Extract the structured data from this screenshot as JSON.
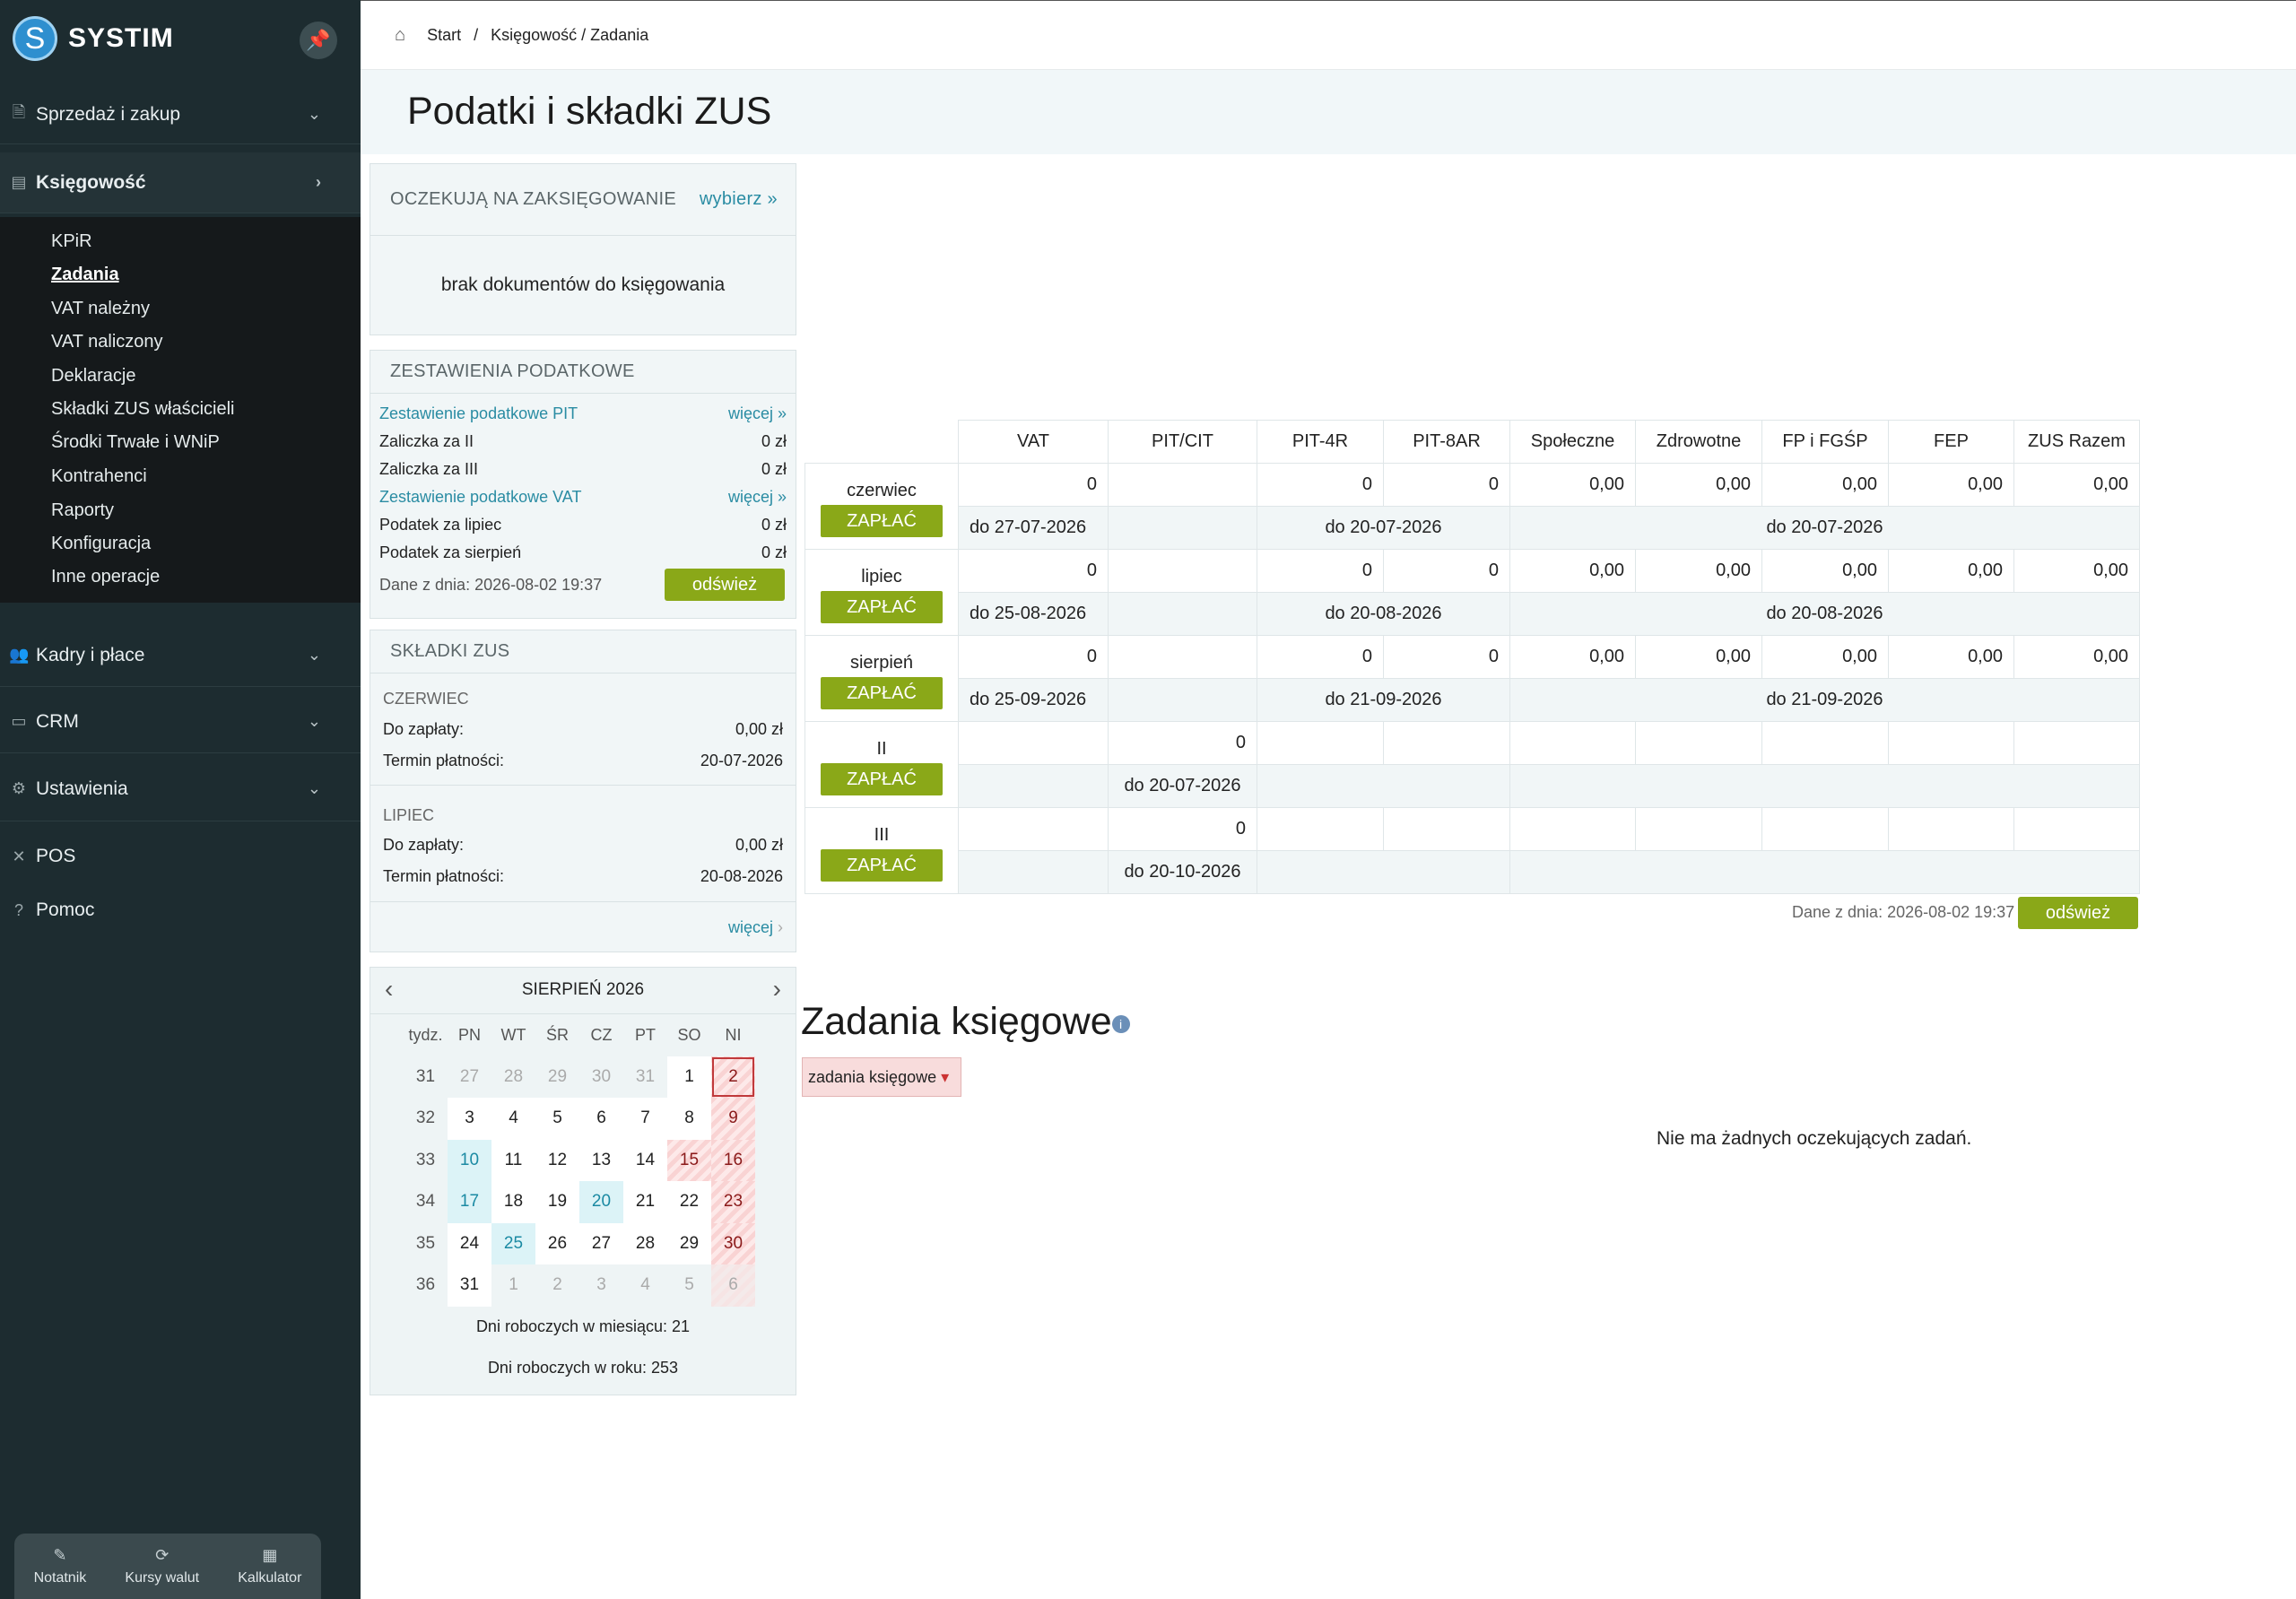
{
  "app": {
    "logo_letter": "S",
    "name": "SYSTIM"
  },
  "sidebar": {
    "sections": [
      {
        "label": "Sprzedaż i zakup",
        "icon": "receipt-icon"
      },
      {
        "label": "Księgowość",
        "icon": "ledger-icon"
      },
      {
        "label": "Kadry i płace",
        "icon": "people-icon"
      },
      {
        "label": "CRM",
        "icon": "card-icon"
      },
      {
        "label": "Ustawienia",
        "icon": "gear-icon"
      },
      {
        "label": "POS",
        "icon": "pos-icon"
      },
      {
        "label": "Pomoc",
        "icon": "help-icon"
      }
    ],
    "sub": [
      "KPiR",
      "Zadania",
      "VAT należny",
      "VAT naliczony",
      "Deklaracje",
      "Składki ZUS właścicieli",
      "Środki Trwałe i WNiP",
      "Kontrahenci",
      "Raporty",
      "Konfiguracja",
      "Inne operacje"
    ],
    "bottom": [
      "Notatnik",
      "Kursy walut",
      "Kalkulator"
    ]
  },
  "breadcrumb": {
    "start": "Start",
    "sep": "/",
    "current": "Księgowość / Zadania"
  },
  "page_title": "Podatki i składki ZUS",
  "pending": {
    "title": "OCZEKUJĄ NA ZAKSIĘGOWANIE",
    "action": "wybierz »",
    "empty": "brak dokumentów do księgowania"
  },
  "tax_summary": {
    "title": "ZESTAWIENIA PODATKOWE",
    "pit_link": "Zestawienie podatkowe PIT",
    "pit_more": "więcej »",
    "r1_label": "Zaliczka za II",
    "r1_value": "0 zł",
    "r2_label": "Zaliczka za III",
    "r2_value": "0 zł",
    "vat_link": "Zestawienie podatkowe VAT",
    "vat_more": "więcej »",
    "r3_label": "Podatek za lipiec",
    "r3_value": "0 zł",
    "r4_label": "Podatek za sierpień",
    "r4_value": "0 zł",
    "date": "Dane z dnia: 2026-08-02 19:37",
    "refresh": "odśwież"
  },
  "zus": {
    "title": "SKŁADKI ZUS",
    "m1": "CZERWIEC",
    "m1_due_label": "Do zapłaty:",
    "m1_due": "0,00 zł",
    "m1_term_label": "Termin płatności:",
    "m1_term": "20-07-2026",
    "m2": "LIPIEC",
    "m2_due_label": "Do zapłaty:",
    "m2_due": "0,00 zł",
    "m2_term_label": "Termin płatności:",
    "m2_term": "20-08-2026",
    "more": "więcej"
  },
  "calendar": {
    "title": "SIERPIEŃ 2026",
    "headers": [
      "tydz.",
      "PN",
      "WT",
      "ŚR",
      "CZ",
      "PT",
      "SO",
      "NI"
    ],
    "weeks": [
      [
        "31",
        "27",
        "28",
        "29",
        "30",
        "31",
        "1",
        "2"
      ],
      [
        "32",
        "3",
        "4",
        "5",
        "6",
        "7",
        "8",
        "9"
      ],
      [
        "33",
        "10",
        "11",
        "12",
        "13",
        "14",
        "15",
        "16"
      ],
      [
        "34",
        "17",
        "18",
        "19",
        "20",
        "21",
        "22",
        "23"
      ],
      [
        "35",
        "24",
        "25",
        "26",
        "27",
        "28",
        "29",
        "30"
      ],
      [
        "36",
        "31",
        "1",
        "2",
        "3",
        "4",
        "5",
        "6"
      ]
    ],
    "work_month": "Dni roboczych w miesiącu: 21",
    "work_year": "Dni roboczych w roku: 253"
  },
  "tax_table": {
    "columns": [
      "VAT",
      "PIT/CIT",
      "PIT-4R",
      "PIT-8AR",
      "Społeczne",
      "Zdrowotne",
      "FP i FGŚP",
      "FEP",
      "ZUS Razem"
    ],
    "pay_label": "ZAPŁAĆ",
    "months": [
      {
        "name": "czerwiec",
        "vat": "0",
        "pit4r": "0",
        "pit8ar": "0",
        "spol": "0,00",
        "zdr": "0,00",
        "fp": "0,00",
        "fep": "0,00",
        "zus": "0,00",
        "d_vat": "do 27-07-2026",
        "d_pit": "do 20-07-2026",
        "d_zus": "do 20-07-2026"
      },
      {
        "name": "lipiec",
        "vat": "0",
        "pit4r": "0",
        "pit8ar": "0",
        "spol": "0,00",
        "zdr": "0,00",
        "fp": "0,00",
        "fep": "0,00",
        "zus": "0,00",
        "d_vat": "do 25-08-2026",
        "d_pit": "do 20-08-2026",
        "d_zus": "do 20-08-2026"
      },
      {
        "name": "sierpień",
        "vat": "0",
        "pit4r": "0",
        "pit8ar": "0",
        "spol": "0,00",
        "zdr": "0,00",
        "fp": "0,00",
        "fep": "0,00",
        "zus": "0,00",
        "d_vat": "do 25-09-2026",
        "d_pit": "do 21-09-2026",
        "d_zus": "do 21-09-2026"
      }
    ],
    "quarters": [
      {
        "name": "II",
        "pit": "0",
        "d_pit": "do 20-07-2026"
      },
      {
        "name": "III",
        "pit": "0",
        "d_pit": "do 20-10-2026"
      }
    ],
    "date": "Dane z dnia: 2026-08-02 19:37",
    "refresh": "odśwież"
  },
  "tasks": {
    "title": "Zadania księgowe",
    "info_icon": "i",
    "filter": "zadania księgowe",
    "empty": "Nie ma żadnych oczekujących zadań."
  }
}
